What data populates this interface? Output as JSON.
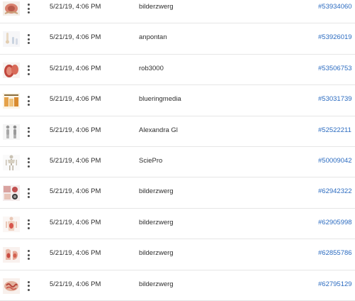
{
  "rows": [
    {
      "thumb": "anatomy-organ-thumbnail",
      "date": "5/21/19, 4:06 PM",
      "author": "bilderzwerg",
      "id": "#53934060"
    },
    {
      "thumb": "bone-joint-thumbnail",
      "date": "5/21/19, 4:06 PM",
      "author": "anpontan",
      "id": "#53926019"
    },
    {
      "thumb": "kidney-organ-thumbnail",
      "date": "5/21/19, 4:06 PM",
      "author": "rob3000",
      "id": "#53506753"
    },
    {
      "thumb": "infographic-chart-thumbnail",
      "date": "5/21/19, 4:06 PM",
      "author": "blueringmedia",
      "id": "#53031739"
    },
    {
      "thumb": "human-figures-thumbnail",
      "date": "5/21/19, 4:06 PM",
      "author": "Alexandra Gl",
      "id": "#52522211"
    },
    {
      "thumb": "skeleton-thumbnail",
      "date": "5/21/19, 4:06 PM",
      "author": "SciePro",
      "id": "#50009042"
    },
    {
      "thumb": "medical-collage-thumbnail",
      "date": "5/21/19, 4:06 PM",
      "author": "bilderzwerg",
      "id": "#62942322"
    },
    {
      "thumb": "torso-anatomy-thumbnail",
      "date": "5/21/19, 4:06 PM",
      "author": "bilderzwerg",
      "id": "#62905998"
    },
    {
      "thumb": "digestive-anatomy-thumbnail",
      "date": "5/21/19, 4:06 PM",
      "author": "bilderzwerg",
      "id": "#62855786"
    },
    {
      "thumb": "intestine-anatomy-thumbnail",
      "date": "5/21/19, 4:06 PM",
      "author": "bilderzwerg",
      "id": "#62795129"
    }
  ],
  "colors": {
    "link": "#2b6bc0",
    "text": "#2f2f2f",
    "divider": "#e6e6e6"
  }
}
